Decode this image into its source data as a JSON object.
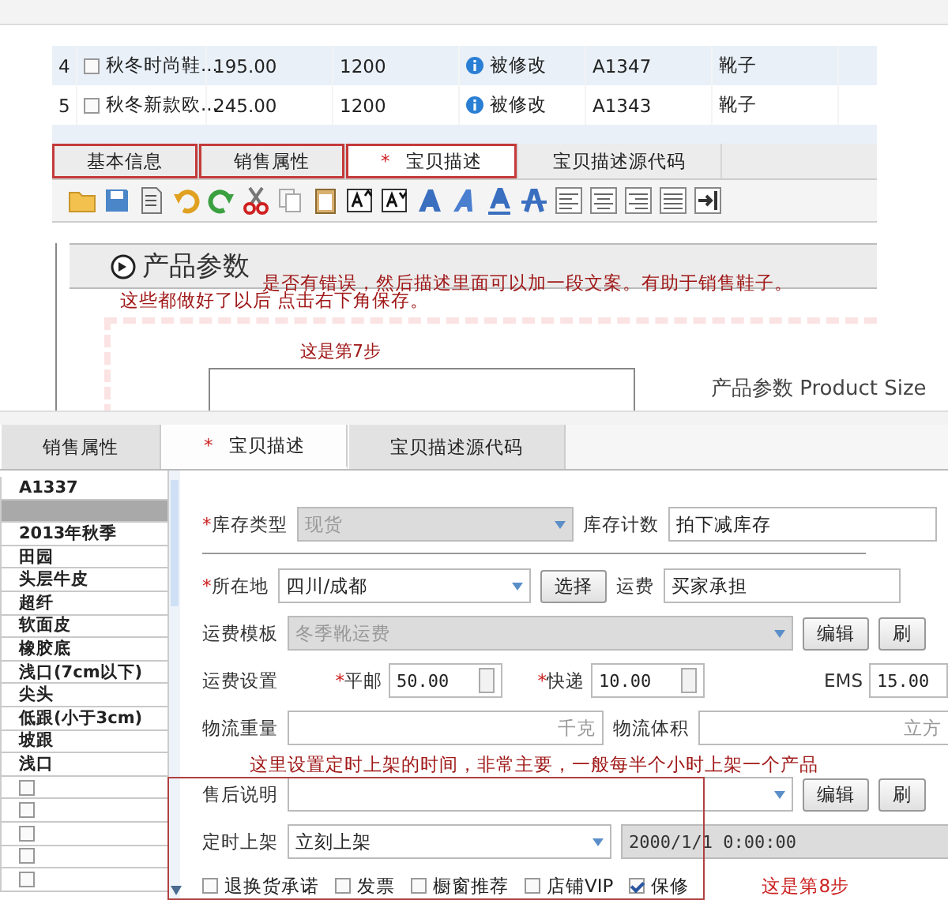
{
  "product_table": {
    "rows": [
      {
        "index": "4",
        "checked": false,
        "name": "秋冬时尚鞋...",
        "price": "195.00",
        "stock": "1200",
        "status": "被修改",
        "code": "A1347",
        "category": "靴子"
      },
      {
        "index": "5",
        "checked": false,
        "name": "秋冬新款欧...",
        "price": "245.00",
        "stock": "1200",
        "status": "被修改",
        "code": "A1343",
        "category": "靴子"
      }
    ]
  },
  "editor": {
    "tabs": [
      {
        "label": "基本信息",
        "selected": false,
        "annotated": true
      },
      {
        "label": "销售属性",
        "selected": false,
        "annotated": true
      },
      {
        "label": "宝贝描述",
        "mark": "*",
        "selected": true,
        "annotated": true
      },
      {
        "label": "宝贝描述源代码",
        "selected": false,
        "annotated": false
      }
    ],
    "heading": "产品参数",
    "notes": [
      "是否有错误，然后描述里面可以加一段文案。有助于销售鞋子。",
      "这些都做好了以后 点击右下角保存。"
    ],
    "step_label": "这是第7步",
    "size_title": "产品参数 Product Size"
  },
  "item_form": {
    "tabs": [
      {
        "label": "销售属性",
        "selected": false
      },
      {
        "label": "宝贝描述",
        "mark": "*",
        "selected": true
      },
      {
        "label": "宝贝描述源代码",
        "selected": false
      }
    ],
    "attributes": [
      {
        "kind": "text",
        "text": "A1337",
        "selected": false
      },
      {
        "kind": "blank",
        "selected": true
      },
      {
        "kind": "text",
        "text": "2013年秋季",
        "selected": false
      },
      {
        "kind": "text",
        "text": "田园",
        "selected": false
      },
      {
        "kind": "text",
        "text": "头层牛皮",
        "selected": false
      },
      {
        "kind": "text",
        "text": "超纤",
        "selected": false
      },
      {
        "kind": "text",
        "text": "软面皮",
        "selected": false
      },
      {
        "kind": "text",
        "text": "橡胶底",
        "selected": false
      },
      {
        "kind": "text",
        "text": "浅口(7cm以下)",
        "selected": false
      },
      {
        "kind": "text",
        "text": "尖头",
        "selected": false
      },
      {
        "kind": "text",
        "text": "低跟(小于3cm)",
        "selected": false
      },
      {
        "kind": "text",
        "text": "坡跟",
        "selected": false
      },
      {
        "kind": "text",
        "text": "浅口",
        "selected": false
      },
      {
        "kind": "checkbox",
        "checked": false,
        "selected": false
      },
      {
        "kind": "checkbox",
        "checked": false,
        "selected": false
      },
      {
        "kind": "checkbox",
        "checked": false,
        "selected": false
      },
      {
        "kind": "checkbox",
        "checked": false,
        "selected": false
      },
      {
        "kind": "checkbox",
        "checked": false,
        "selected": false
      }
    ],
    "stock_type": {
      "label": "库存类型",
      "mark": "*",
      "value": "现货",
      "disabled": true
    },
    "stock_count": {
      "label": "库存计数",
      "value": "拍下减库存"
    },
    "location": {
      "label": "所在地",
      "mark": "*",
      "value": "四川/成都",
      "button": "选择"
    },
    "freight": {
      "label": "运费",
      "value": "买家承担"
    },
    "freight_template": {
      "label": "运费模板",
      "value": "冬季靴运费",
      "disabled": true,
      "buttons": [
        "编辑",
        "刷"
      ]
    },
    "freight_settings": {
      "label": "运费设置",
      "fields": [
        {
          "kind": "spinner",
          "mark": "*",
          "label": "平邮",
          "value": "50.00"
        },
        {
          "kind": "spinner",
          "mark": "*",
          "label": "快递",
          "value": "10.00"
        },
        {
          "kind": "plain",
          "label": "EMS",
          "value": "15.00"
        }
      ]
    },
    "weight": {
      "label": "物流重量",
      "unit": "千克"
    },
    "volume": {
      "label": "物流体积",
      "unit": "立方"
    },
    "schedule_note": "这里设置定时上架的时间，非常主要，一般每半个小时上架一个产品",
    "after_sale": {
      "label": "售后说明",
      "buttons": [
        "编辑",
        "刷"
      ]
    },
    "scheduled": {
      "label": "定时上架",
      "value": "立刻上架",
      "datetime": "2000/1/1 0:00:00"
    },
    "options": [
      {
        "label": "退换货承诺",
        "checked": false
      },
      {
        "label": "发票",
        "checked": false
      },
      {
        "label": "橱窗推荐",
        "checked": false
      },
      {
        "label": "店铺VIP",
        "checked": false
      },
      {
        "label": "保修",
        "checked": true
      }
    ],
    "step_label": "这是第8步"
  }
}
